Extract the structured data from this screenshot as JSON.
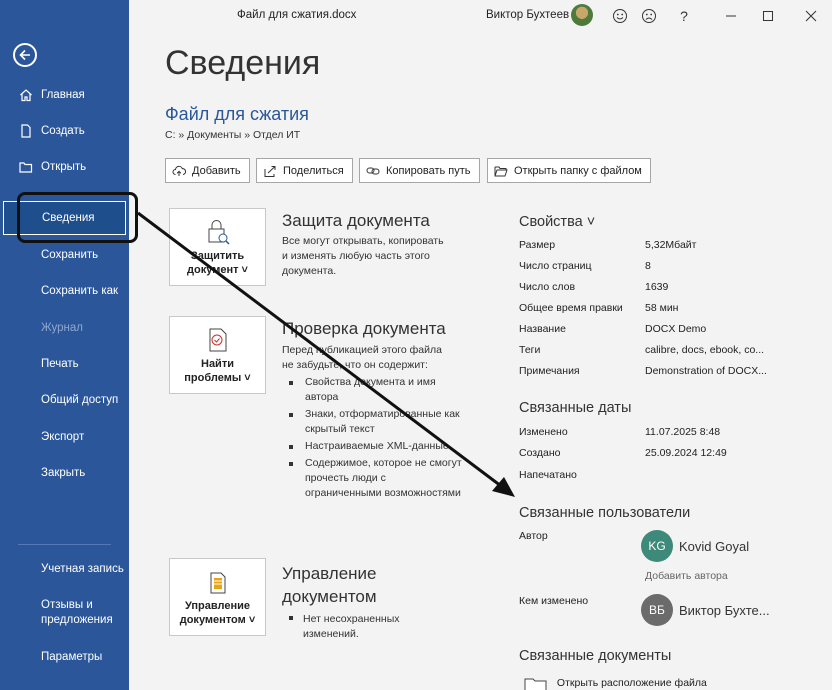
{
  "window": {
    "document_title": "Файл для сжатия.docx",
    "user_name": "Виктор Бухтеев",
    "icons": [
      "smile-icon",
      "frown-icon",
      "help-icon",
      "minimize-icon",
      "maximize-icon",
      "close-icon"
    ]
  },
  "nav": {
    "items": [
      {
        "label": "Главная",
        "icon": "home-icon"
      },
      {
        "label": "Создать",
        "icon": "new-doc-icon"
      },
      {
        "label": "Открыть",
        "icon": "folder-icon"
      },
      {
        "label": "Сведения"
      },
      {
        "label": "Сохранить"
      },
      {
        "label": "Сохранить как"
      },
      {
        "label": "Журнал"
      },
      {
        "label": "Печать"
      },
      {
        "label": "Общий доступ"
      },
      {
        "label": "Экспорт"
      },
      {
        "label": "Закрыть"
      },
      {
        "label": "Учетная запись"
      },
      {
        "label": "Отзывы и предложения"
      },
      {
        "label": "Параметры"
      }
    ],
    "active": "Сведения",
    "colors": {
      "background": "#2b579a"
    }
  },
  "main": {
    "page_title": "Сведения",
    "file_title": "Файл для сжатия",
    "breadcrumb": "C: » Документы » Отдел ИТ",
    "buttons": {
      "add": "Добавить",
      "share": "Поделиться",
      "copy_path": "Копировать путь",
      "open_folder": "Открыть папку с файлом"
    },
    "protect": {
      "tile_line1": "Защитить",
      "tile_line2": "документ ˅",
      "title": "Защита документа",
      "text_lines": [
        "Все могут открывать, копировать",
        "и изменять любую часть этого",
        "документа."
      ]
    },
    "inspect": {
      "tile_line1": "Найти",
      "tile_line2": "проблемы ˅",
      "title": "Проверка документа",
      "text_lines": [
        "Перед публикацией этого файла",
        "не забудьте, что он содержит:"
      ],
      "bullets": [
        "Свойства документа и имя автора",
        "Знаки, отформатированные как скрытый текст",
        "Настраиваемые XML-данные",
        "Содержимое, которое не смогут прочесть люди с ограниченными возможностями"
      ]
    },
    "manage": {
      "tile_line1": "Управление",
      "tile_line2": "документом ˅",
      "title_line1": "Управление",
      "title_line2": "документом",
      "status_line1": "Нет несохраненных",
      "status_line2": "изменений."
    }
  },
  "properties": {
    "title": "Свойства ˅",
    "rows": [
      {
        "label": "Размер",
        "value": "5,32Мбайт"
      },
      {
        "label": "Число страниц",
        "value": "8"
      },
      {
        "label": "Число слов",
        "value": "1639"
      },
      {
        "label": "Общее время правки",
        "value": "58 мин"
      },
      {
        "label": "Название",
        "value": "DOCX Demo"
      },
      {
        "label": "Теги",
        "value": "calibre, docs, ebook, co..."
      },
      {
        "label": "Примечания",
        "value": "Demonstration of DOCX..."
      }
    ],
    "dates_title": "Связанные даты",
    "dates": [
      {
        "label": "Изменено",
        "value": "11.07.2025 8:48"
      },
      {
        "label": "Создано",
        "value": "25.09.2024 12:49"
      },
      {
        "label": "Напечатано",
        "value": ""
      }
    ],
    "people_title": "Связанные пользователи",
    "author_label": "Автор",
    "author": {
      "initials": "KG",
      "name": "Kovid Goyal",
      "color": "#3e8a7a"
    },
    "add_author": "Добавить автора",
    "modified_by_label": "Кем изменено",
    "modified_by": {
      "initials": "ВБ",
      "name": "Виктор Бухте...",
      "color": "#6b6b6b"
    },
    "related_docs_title": "Связанные документы",
    "open_location": "Открыть расположение файла"
  }
}
